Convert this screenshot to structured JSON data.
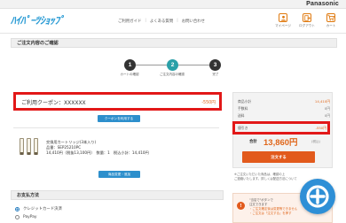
{
  "brand": {
    "corp": "Panasonic",
    "logo": "ﾊｲﾊﾟｰﾂｼｮｯﾌﾟ"
  },
  "header": {
    "nav": [
      "ご利用ガイド",
      "よくある質問",
      "お問い合わせ"
    ],
    "icons": [
      {
        "label": "マイページ",
        "icon": "user-icon"
      },
      {
        "label": "ログアウト",
        "icon": "logout-icon"
      },
      {
        "label": "カート",
        "icon": "cart-icon",
        "count": "1"
      }
    ]
  },
  "page": {
    "title": "ご注文内容のご確認"
  },
  "steps": [
    {
      "num": "1",
      "label": "カートの確認",
      "state": "done",
      "color": "#333333"
    },
    {
      "num": "2",
      "label": "ご注文内容の確認",
      "state": "current",
      "color": "#2aa0a8"
    },
    {
      "num": "3",
      "label": "完了",
      "state": "todo",
      "color": "#333333"
    }
  ],
  "coupon": {
    "label": "ご利用クーポン：XXXXXX",
    "amount": "-550円",
    "button": "クーポンを利用する"
  },
  "product": {
    "name": "交換用カートリッジ(3本入り)",
    "model": "品番：SEP25210PC",
    "price": "14,410円（税抜13,100円）　数量：1　税込小計：14,410円",
    "change_button": "商品変更・追加"
  },
  "payment": {
    "title": "お支払方法",
    "options": [
      {
        "label": "クレジットカード決済",
        "selected": true
      },
      {
        "label": "PayPay",
        "selected": false
      }
    ]
  },
  "summary": {
    "rows": [
      {
        "label": "商品小計",
        "value": "14,410円",
        "accent": true
      },
      {
        "label": "手数料",
        "value": "0円",
        "accent": false
      },
      {
        "label": "送料",
        "value": "0円",
        "accent": false
      },
      {
        "label": "値引き",
        "value": "-550円",
        "accent": true
      }
    ],
    "total_label": "合計",
    "total_value": "13,860円",
    "total_tax": "(税込)",
    "order_button": "注文する",
    "note": [
      "※ご注文いただいた商品は、確認の上",
      "ご連絡いたします。詳しくは配送方法について"
    ],
    "promo": [
      "\"当店で\"ボタンで",
      "注文できます",
      "・ご注文確定後は変更等できません",
      "・ご注文は「注文する」を押す"
    ]
  },
  "zoom": {
    "icon": "zoom-in-icon"
  },
  "colors": {
    "accent": "#e0661a",
    "blue": "#2d8fcc",
    "highlight": "#e21818"
  }
}
